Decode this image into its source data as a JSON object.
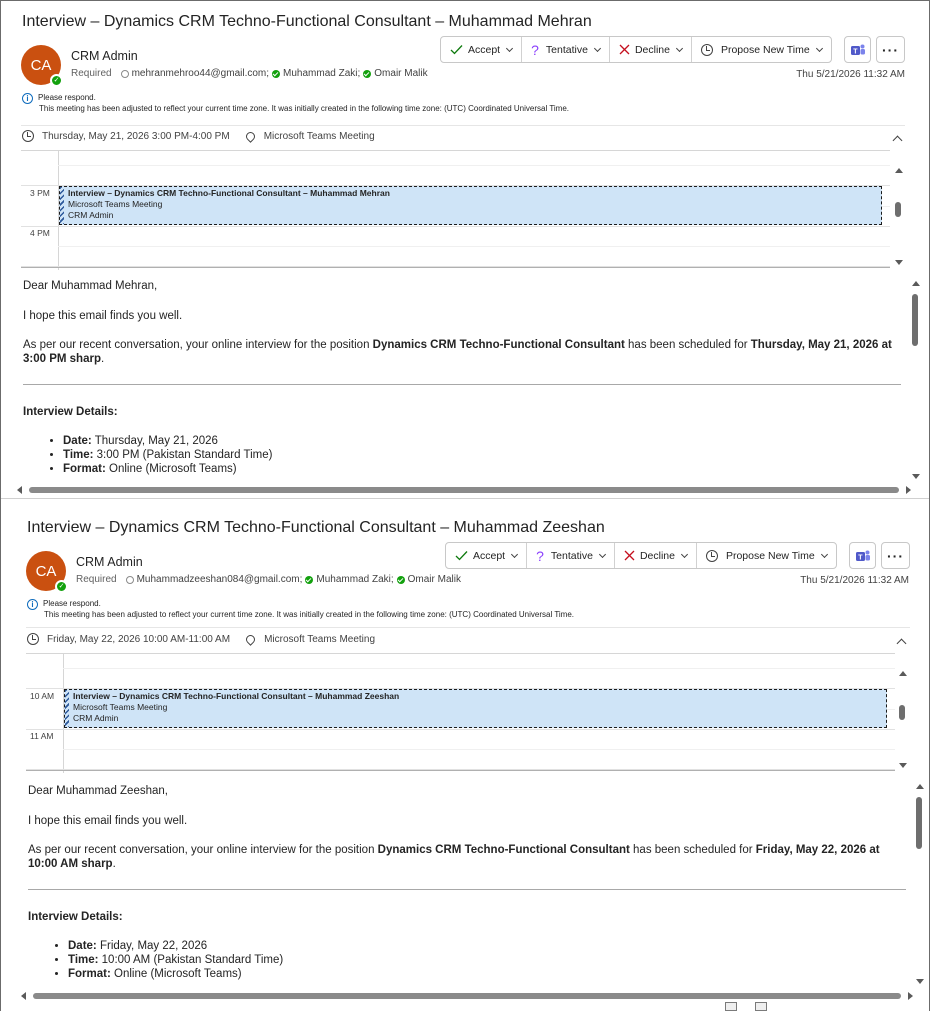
{
  "colors": {
    "accent": "#0f6cbd",
    "avatar": "#ca5010",
    "event_fill": "#cfe4f7",
    "status_ok": "#13a10e"
  },
  "messages": [
    {
      "subject": "Interview – Dynamics CRM Techno-Functional Consultant – Muhammad Mehran",
      "avatar_initials": "CA",
      "sender": "CRM Admin",
      "required_label": "Required",
      "recipients": [
        "mehranmehroo44@gmail.com;",
        "Muhammad Zaki;",
        "Omair Malik"
      ],
      "actions": {
        "accept": "Accept",
        "tentative": "Tentative",
        "decline": "Decline",
        "propose": "Propose New Time"
      },
      "more_label": "···",
      "datetime": "Thu 5/21/2026 11:32 AM",
      "notice_line1": "Please respond.",
      "notice_line2": "This meeting has been adjusted to reflect your current time zone. It was initially created in the following time zone: (UTC) Coordinated Universal Time.",
      "when": "Thursday, May 21, 2026 3:00 PM-4:00 PM",
      "location": "Microsoft Teams Meeting",
      "hour1": "3 PM",
      "hour2": "4 PM",
      "event_title": "Interview – Dynamics CRM Techno-Functional Consultant – Muhammad Mehran",
      "event_location": "Microsoft Teams Meeting",
      "event_organizer": "CRM Admin",
      "greeting": "Dear Muhammad Mehran,",
      "line1": "I hope this email finds you well.",
      "para_prefix": "As per our recent conversation, your online interview for the position ",
      "position": "Dynamics CRM Techno-Functional Consultant",
      "para_mid": " has been scheduled for ",
      "scheduled": "Thursday, May 21, 2026 at 3:00 PM sharp",
      "para_end": ".",
      "details_heading": "Interview Details:",
      "details": [
        {
          "label": "Date:",
          "value": " Thursday, May 21, 2026"
        },
        {
          "label": "Time:",
          "value": " 3:00 PM (Pakistan Standard Time)"
        },
        {
          "label": "Format:",
          "value": " Online (Microsoft Teams)"
        }
      ]
    },
    {
      "subject": "Interview – Dynamics CRM Techno-Functional Consultant – Muhammad Zeeshan",
      "avatar_initials": "CA",
      "sender": "CRM Admin",
      "required_label": "Required",
      "recipients": [
        "Muhammadzeeshan084@gmail.com;",
        "Muhammad Zaki;",
        "Omair Malik"
      ],
      "actions": {
        "accept": "Accept",
        "tentative": "Tentative",
        "decline": "Decline",
        "propose": "Propose New Time"
      },
      "more_label": "···",
      "datetime": "Thu 5/21/2026 11:32 AM",
      "notice_line1": "Please respond.",
      "notice_line2": "This meeting has been adjusted to reflect your current time zone. It was initially created in the following time zone: (UTC) Coordinated Universal Time.",
      "when": "Friday, May 22, 2026 10:00 AM-11:00 AM",
      "location": "Microsoft Teams Meeting",
      "hour1": "10 AM",
      "hour2": "11 AM",
      "event_title": "Interview – Dynamics CRM Techno-Functional Consultant – Muhammad Zeeshan",
      "event_location": "Microsoft Teams Meeting",
      "event_organizer": "CRM Admin",
      "greeting": "Dear Muhammad Zeeshan,",
      "line1": "I hope this email finds you well.",
      "para_prefix": "As per our recent conversation, your online interview for the position ",
      "position": "Dynamics CRM Techno-Functional Consultant",
      "para_mid": " has been scheduled for ",
      "scheduled": "Friday, May 22, 2026 at 10:00 AM sharp",
      "para_end": ".",
      "details_heading": "Interview Details:",
      "details": [
        {
          "label": "Date:",
          "value": " Friday, May 22, 2026"
        },
        {
          "label": "Time:",
          "value": " 10:00 AM (Pakistan Standard Time)"
        },
        {
          "label": "Format:",
          "value": " Online (Microsoft Teams)"
        }
      ]
    }
  ]
}
